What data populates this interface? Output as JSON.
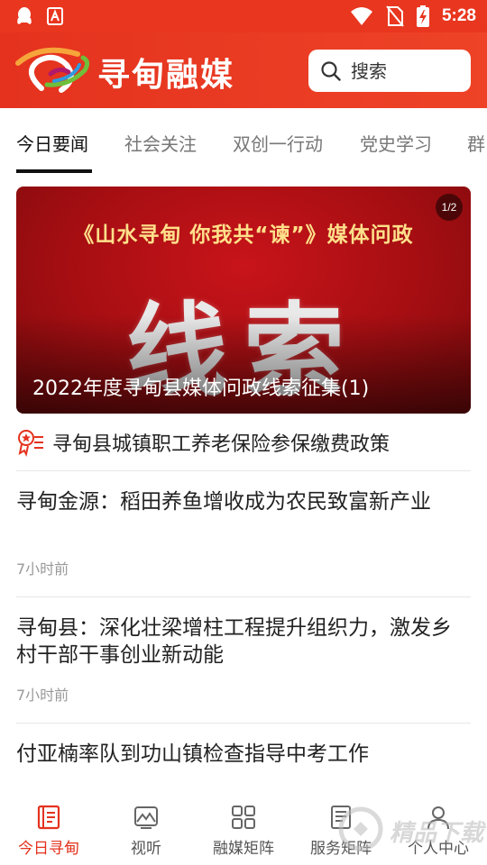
{
  "status_bar": {
    "time": "5:28",
    "icons": [
      "qq-icon",
      "app-notification-icon",
      "wifi-icon",
      "no-sim-icon",
      "battery-charging-icon"
    ]
  },
  "header": {
    "app_title": "寻甸融媒",
    "search_placeholder": "搜索"
  },
  "tabs": [
    {
      "label": "今日要闻",
      "active": true
    },
    {
      "label": "社会关注",
      "active": false
    },
    {
      "label": "双创一行动",
      "active": false
    },
    {
      "label": "党史学习",
      "active": false
    },
    {
      "label": "群",
      "active": false
    }
  ],
  "banner": {
    "headline": "《山水寻甸 你我共“谏”》媒体问政",
    "big_text": "线索",
    "caption": "2022年度寻甸县媒体问政线索征集(1)",
    "page_indicator": "1/2"
  },
  "notice": {
    "text": "寻甸县城镇职工养老保险参保缴费政策"
  },
  "news": [
    {
      "title": "寻甸金源：稻田养鱼增收成为农民致富新产业",
      "time": "7小时前"
    },
    {
      "title": "寻甸县：深化壮梁增柱工程提升组织力，激发乡村干部干事创业新动能",
      "time": "7小时前"
    },
    {
      "title": "付亚楠率队到功山镇检查指导中考工作",
      "time": ""
    }
  ],
  "bottom_nav": [
    {
      "label": "今日寻甸",
      "icon": "news-doc-icon",
      "active": true
    },
    {
      "label": "视听",
      "icon": "video-hills-icon",
      "active": false
    },
    {
      "label": "融媒矩阵",
      "icon": "grid-matrix-icon",
      "active": false
    },
    {
      "label": "服务矩阵",
      "icon": "service-doc-icon",
      "active": false
    },
    {
      "label": "个人中心",
      "icon": "person-icon",
      "active": false
    }
  ],
  "colors": {
    "brand_red": "#e4321e",
    "active_nav": "#e4321e",
    "banner_text_gold": "#ffe08a"
  },
  "watermark": {
    "text": "精品下载"
  }
}
